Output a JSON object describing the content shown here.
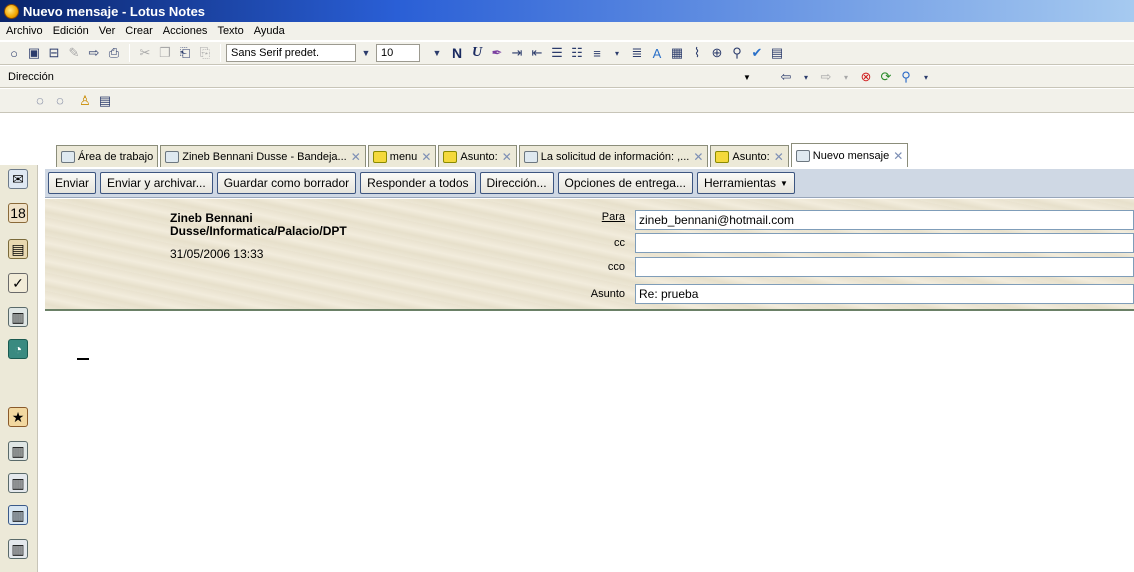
{
  "window": {
    "title": "Nuevo mensaje - Lotus Notes"
  },
  "menu": [
    "Archivo",
    "Edición",
    "Ver",
    "Crear",
    "Acciones",
    "Texto",
    "Ayuda"
  ],
  "format": {
    "font": "Sans Serif predet.",
    "size": "10",
    "bold": "N",
    "italic": "U"
  },
  "address": {
    "label": "Dirección"
  },
  "tabs": [
    {
      "label": "Área de trabajo",
      "closable": false
    },
    {
      "label": "Zineb Bennani Dusse - Bandeja...",
      "closable": true
    },
    {
      "label": "menu",
      "closable": true
    },
    {
      "label": "Asunto:",
      "closable": true
    },
    {
      "label": "La solicitud de información: ,...",
      "closable": true
    },
    {
      "label": "Asunto:",
      "closable": true
    },
    {
      "label": "Nuevo mensaje",
      "closable": true
    }
  ],
  "actions": {
    "send": "Enviar",
    "send_archive": "Enviar y archivar...",
    "save_draft": "Guardar como borrador",
    "reply_all": "Responder a todos",
    "address": "Dirección...",
    "delivery_options": "Opciones de entrega...",
    "tools": "Herramientas"
  },
  "message": {
    "from_line1": "Zineb Bennani",
    "from_line2": "Dusse/Informatica/Palacio/DPT",
    "date": "31/05/2006 13:33",
    "to_label": "Para",
    "to_value": "zineb_bennani@hotmail.com",
    "cc_label": "cc",
    "cc_value": "",
    "bcc_label": "cco",
    "bcc_value": "",
    "subject_label": "Asunto",
    "subject_value": "Re: prueba"
  }
}
